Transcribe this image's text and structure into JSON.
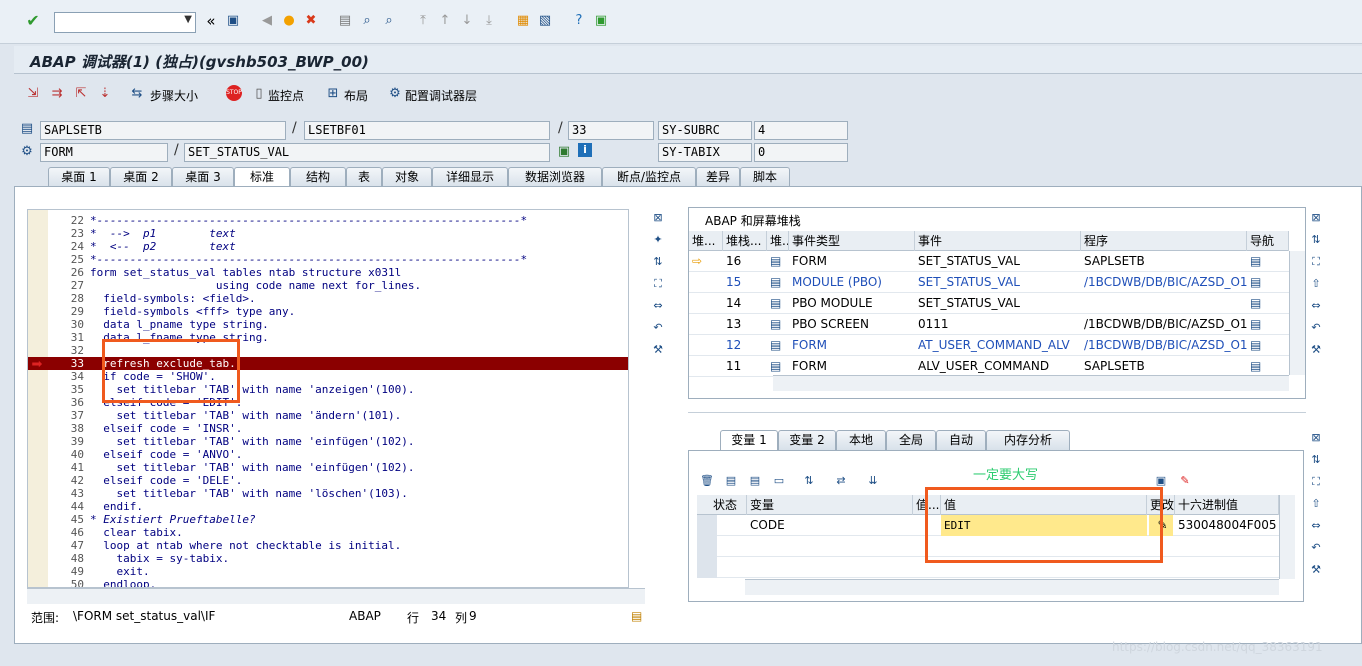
{
  "app": {
    "title": "ABAP 调试器(1)  (独占)(gvshb503_BWP_00)"
  },
  "toolbar": {
    "command_value": ""
  },
  "appbar": {
    "step_size": "步骤大小",
    "watchpoint": "监控点",
    "layout": "布局",
    "config_layers": "配置调试器层"
  },
  "context": {
    "row1": {
      "program": "SAPLSETB",
      "include": "LSETBF01",
      "line": "33",
      "sy_name": "SY-SUBRC",
      "sy_value": "4"
    },
    "row2": {
      "type": "FORM",
      "name": "SET_STATUS_VAL",
      "sy_name": "SY-TABIX",
      "sy_value": "0"
    }
  },
  "tabs": [
    "桌面 1",
    "桌面 2",
    "桌面 3",
    "标准",
    "结构",
    "表",
    "对象",
    "详细显示",
    "数据浏览器",
    "断点/监控点",
    "差异",
    "脚本"
  ],
  "active_tab": "标准",
  "code": {
    "lines": [
      {
        "n": "22",
        "t": "*----------------------------------------------------------------*"
      },
      {
        "n": "23",
        "t": "*  -->  p1        text"
      },
      {
        "n": "24",
        "t": "*  <--  p2        text"
      },
      {
        "n": "25",
        "t": "*----------------------------------------------------------------*"
      },
      {
        "n": "26",
        "t": "form set_status_val tables ntab structure x031l"
      },
      {
        "n": "27",
        "t": "                   using code name next for_lines."
      },
      {
        "n": "28",
        "t": "  field-symbols: <field>."
      },
      {
        "n": "29",
        "t": "  field-symbols <fff> type any."
      },
      {
        "n": "30",
        "t": "  data l_pname type string."
      },
      {
        "n": "31",
        "t": "  data l_fname type string."
      },
      {
        "n": "32",
        "t": ""
      },
      {
        "n": "33",
        "t": "  refresh exclude_tab."
      },
      {
        "n": "34",
        "t": "  if code = 'SHOW'."
      },
      {
        "n": "35",
        "t": "    set titlebar 'TAB' with name 'anzeigen'(100)."
      },
      {
        "n": "36",
        "t": "  elseif code = 'EDIT'."
      },
      {
        "n": "37",
        "t": "    set titlebar 'TAB' with name 'ändern'(101)."
      },
      {
        "n": "38",
        "t": "  elseif code = 'INSR'."
      },
      {
        "n": "39",
        "t": "    set titlebar 'TAB' with name 'einfügen'(102)."
      },
      {
        "n": "40",
        "t": "  elseif code = 'ANVO'."
      },
      {
        "n": "41",
        "t": "    set titlebar 'TAB' with name 'einfügen'(102)."
      },
      {
        "n": "42",
        "t": "  elseif code = 'DELE'."
      },
      {
        "n": "43",
        "t": "    set titlebar 'TAB' with name 'löschen'(103)."
      },
      {
        "n": "44",
        "t": "  endif."
      },
      {
        "n": "45",
        "t": "* Existiert Prueftabelle?"
      },
      {
        "n": "46",
        "t": "  clear tabix."
      },
      {
        "n": "47",
        "t": "  loop at ntab where not checktable is initial."
      },
      {
        "n": "48",
        "t": "    tabix = sy-tabix."
      },
      {
        "n": "49",
        "t": "    exit."
      },
      {
        "n": "50",
        "t": "  endloop."
      }
    ],
    "current_line": "33"
  },
  "status": {
    "scope_label": "范围:",
    "scope": "\\FORM set_status_val\\IF",
    "lang": "ABAP",
    "row_label": "行",
    "row": "34",
    "col_label": "列",
    "col": "9"
  },
  "stack": {
    "title": "ABAP 和屏幕堆栈",
    "headers": [
      "堆...",
      "堆栈...",
      "堆...",
      "事件类型",
      "事件",
      "程序",
      "导航"
    ],
    "rows": [
      {
        "level": "16",
        "type": "FORM",
        "event": "SET_STATUS_VAL",
        "program": "SAPLSETB",
        "link": false,
        "current": true
      },
      {
        "level": "15",
        "type": "MODULE (PBO)",
        "event": "SET_STATUS_VAL",
        "program": "/1BCDWB/DB/BIC/AZSD_O1...",
        "link": true,
        "current": false
      },
      {
        "level": "14",
        "type": "PBO MODULE",
        "event": "SET_STATUS_VAL",
        "program": "",
        "link": false,
        "current": false
      },
      {
        "level": "13",
        "type": "PBO SCREEN",
        "event": "0111",
        "program": "/1BCDWB/DB/BIC/AZSD_O1...",
        "link": false,
        "current": false
      },
      {
        "level": "12",
        "type": "FORM",
        "event": "AT_USER_COMMAND_ALV",
        "program": "/1BCDWB/DB/BIC/AZSD_O1...",
        "link": true,
        "current": false
      },
      {
        "level": "11",
        "type": "FORM",
        "event": "ALV_USER_COMMAND",
        "program": "SAPLSETB",
        "link": false,
        "current": false
      }
    ]
  },
  "var_tabs": [
    "变量 1",
    "变量 2",
    "本地",
    "全局",
    "自动",
    "内存分析"
  ],
  "vars": {
    "headers": [
      "状态",
      "变量",
      "值...",
      "值",
      "更改",
      "十六进制值"
    ],
    "rows": [
      {
        "name": "CODE",
        "value": "EDIT",
        "hex": "530048004F005"
      }
    ]
  },
  "annotation": "一定要大写",
  "watermark": "https://blog.csdn.net/qq_38363191"
}
